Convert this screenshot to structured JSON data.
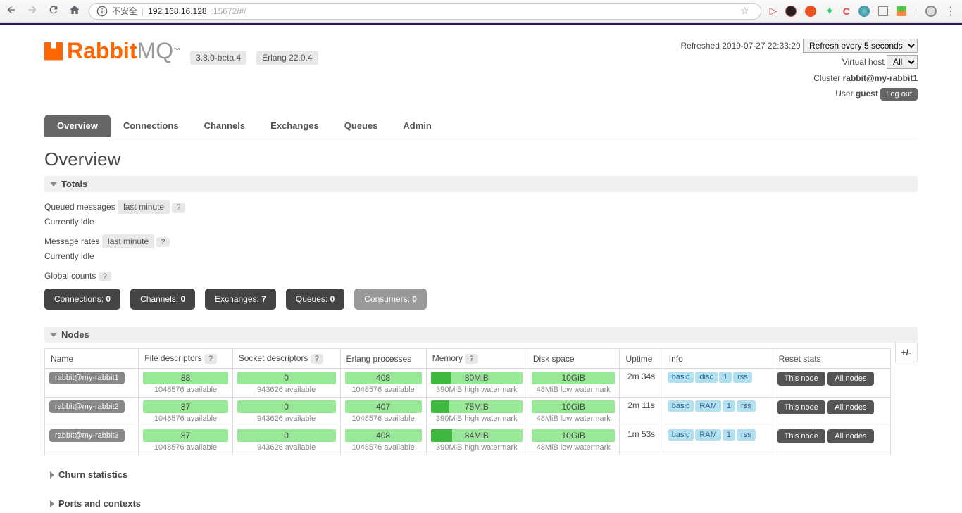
{
  "browser": {
    "insecure_label": "不安全",
    "url_host": "192.168.16.128",
    "url_port": ":15672/#/"
  },
  "header": {
    "logo_rabbit": "Rabbit",
    "logo_mq": "MQ",
    "logo_tm": "™",
    "version": "3.8.0-beta.4",
    "erlang": "Erlang 22.0.4",
    "refreshed_label": "Refreshed",
    "refreshed_time": "2019-07-27 22:33:29",
    "refresh_select": "Refresh every 5 seconds",
    "vhost_label": "Virtual host",
    "vhost_value": "All",
    "cluster_label": "Cluster",
    "cluster_value": "rabbit@my-rabbit1",
    "user_label": "User",
    "user_value": "guest",
    "logout": "Log out"
  },
  "tabs": [
    "Overview",
    "Connections",
    "Channels",
    "Exchanges",
    "Queues",
    "Admin"
  ],
  "active_tab": "Overview",
  "page_title": "Overview",
  "totals": {
    "hdr": "Totals",
    "queued_label": "Queued messages",
    "last_minute": "last minute",
    "idle": "Currently idle",
    "rates_label": "Message rates",
    "global_counts": "Global counts"
  },
  "counts": [
    {
      "label": "Connections:",
      "value": "0",
      "light": false
    },
    {
      "label": "Channels:",
      "value": "0",
      "light": false
    },
    {
      "label": "Exchanges:",
      "value": "7",
      "light": false
    },
    {
      "label": "Queues:",
      "value": "0",
      "light": false
    },
    {
      "label": "Consumers:",
      "value": "0",
      "light": true
    }
  ],
  "nodes": {
    "hdr": "Nodes",
    "cols": [
      "Name",
      "File descriptors",
      "Socket descriptors",
      "Erlang processes",
      "Memory",
      "Disk space",
      "Uptime",
      "Info",
      "Reset stats"
    ],
    "plusminus": "+/-",
    "fd_avail": "1048576 available",
    "sd_avail": "943626 available",
    "ep_avail": "1048576 available",
    "mem_hwm": "390MiB high watermark",
    "disk_lwm": "48MiB low watermark",
    "this_node": "This node",
    "all_nodes": "All nodes",
    "rows": [
      {
        "name": "rabbit@my-rabbit1",
        "fd": "88",
        "sd": "0",
        "ep": "408",
        "mem": "80MiB",
        "mem_pct": 22,
        "disk": "10GiB",
        "uptime": "2m 34s",
        "info": [
          "basic",
          "disc",
          "1",
          "rss"
        ]
      },
      {
        "name": "rabbit@my-rabbit2",
        "fd": "87",
        "sd": "0",
        "ep": "407",
        "mem": "75MiB",
        "mem_pct": 20,
        "disk": "10GiB",
        "uptime": "2m 11s",
        "info": [
          "basic",
          "RAM",
          "1",
          "rss"
        ]
      },
      {
        "name": "rabbit@my-rabbit3",
        "fd": "87",
        "sd": "0",
        "ep": "408",
        "mem": "84MiB",
        "mem_pct": 23,
        "disk": "10GiB",
        "uptime": "1m 53s",
        "info": [
          "basic",
          "RAM",
          "1",
          "rss"
        ]
      }
    ]
  },
  "sections": {
    "churn": "Churn statistics",
    "ports": "Ports and contexts"
  }
}
